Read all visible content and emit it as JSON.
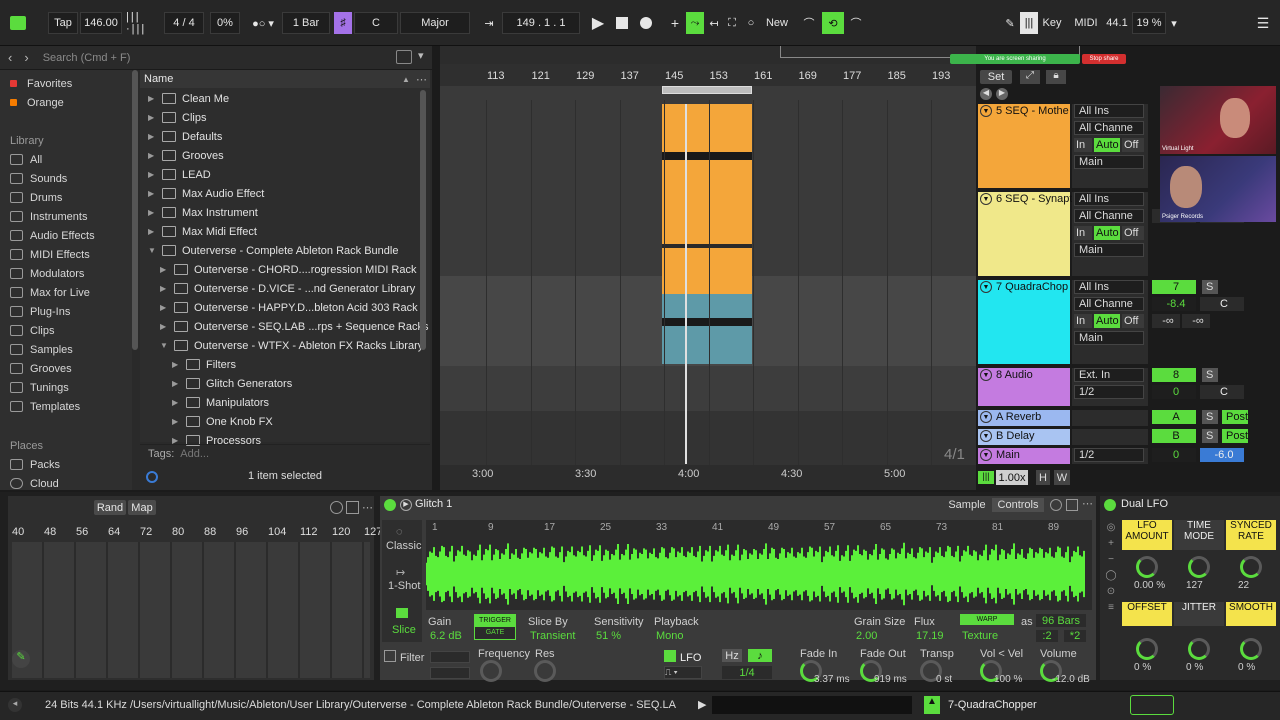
{
  "transport": {
    "tap": "Tap",
    "tempo": "146.00",
    "signature": "4 / 4",
    "swing": "0%",
    "quantize": "1 Bar",
    "key": "C",
    "scale": "Major",
    "position": "149 .   1 .   1",
    "new_label": "New",
    "key_map": "Key",
    "midi_map": "MIDI",
    "sample_rate": "44.1",
    "cpu": "19 %"
  },
  "browser": {
    "search_placeholder": "Search (Cmd + F)",
    "name_header": "Name",
    "collections": [
      {
        "label": "Favorites",
        "color": "#e53935"
      },
      {
        "label": "Orange",
        "color": "#f57c00"
      }
    ],
    "library_header": "Library",
    "library": [
      "All",
      "Sounds",
      "Drums",
      "Instruments",
      "Audio Effects",
      "MIDI Effects",
      "Modulators",
      "Max for Live",
      "Plug-Ins",
      "Clips",
      "Samples",
      "Grooves",
      "Tunings",
      "Templates"
    ],
    "places_header": "Places",
    "places": [
      "Packs",
      "Cloud"
    ],
    "files": [
      {
        "label": "Clean Me",
        "indent": 0,
        "open": false
      },
      {
        "label": "Clips",
        "indent": 0,
        "open": false
      },
      {
        "label": "Defaults",
        "indent": 0,
        "open": false
      },
      {
        "label": "Grooves",
        "indent": 0,
        "open": false
      },
      {
        "label": "LEAD",
        "indent": 0,
        "open": false
      },
      {
        "label": "Max Audio Effect",
        "indent": 0,
        "open": false
      },
      {
        "label": "Max Instrument",
        "indent": 0,
        "open": false
      },
      {
        "label": "Max Midi Effect",
        "indent": 0,
        "open": false
      },
      {
        "label": "Outerverse - Complete Ableton Rack Bundle",
        "indent": 0,
        "open": true
      },
      {
        "label": "Outerverse - CHORD....rogression MIDI Rack",
        "indent": 1,
        "open": false
      },
      {
        "label": "Outerverse - D.VICE - ...nd Generator Library",
        "indent": 1,
        "open": false
      },
      {
        "label": "Outerverse - HAPPY.D...bleton Acid 303 Rack",
        "indent": 1,
        "open": false
      },
      {
        "label": "Outerverse - SEQ.LAB ...rps + Sequence Racks",
        "indent": 1,
        "open": false
      },
      {
        "label": "Outerverse - WTFX - Ableton FX Racks Library",
        "indent": 1,
        "open": true
      },
      {
        "label": "Filters",
        "indent": 2,
        "open": false
      },
      {
        "label": "Glitch Generators",
        "indent": 2,
        "open": false
      },
      {
        "label": "Manipulators",
        "indent": 2,
        "open": false
      },
      {
        "label": "One Knob FX",
        "indent": 2,
        "open": false
      },
      {
        "label": "Processors",
        "indent": 2,
        "open": false
      }
    ],
    "tags_label": "Tags:",
    "tags_placeholder": "Add...",
    "status": "1 item selected"
  },
  "arrangement": {
    "bar_numbers": [
      "113",
      "121",
      "129",
      "137",
      "145",
      "153",
      "161",
      "169",
      "177",
      "185",
      "193"
    ],
    "time_markers": [
      "3:00",
      "3:30",
      "4:00",
      "4:30",
      "5:00"
    ],
    "set_label": "Set",
    "signature_display": "4/1",
    "zoom": "1.00x",
    "h_label": "H",
    "w_label": "W",
    "screen_share_text": "You are screen sharing",
    "stop_share": "Stop share"
  },
  "tracks": [
    {
      "name": "5 SEQ - Mothe",
      "color": "#f4a63a",
      "input": "All Ins",
      "channel": "All Channe",
      "output": "Main",
      "monitor": [
        "In",
        "Auto",
        "Off"
      ]
    },
    {
      "name": "6 SEQ - Synapt",
      "color": "#f0e88a",
      "input": "All Ins",
      "channel": "All Channe",
      "output": "Main",
      "monitor": [
        "In",
        "Auto",
        "Off"
      ],
      "vol": "-∞",
      "pan": "-∞"
    },
    {
      "name": "7 QuadraChop",
      "color": "#22e6f0",
      "input": "All Ins",
      "channel": "All Channe",
      "output": "Main",
      "monitor": [
        "In",
        "Auto",
        "Off"
      ],
      "num": "7",
      "vol": "-8.4",
      "pan": "C",
      "sends": [
        "-∞",
        "-∞"
      ]
    },
    {
      "name": "8 Audio",
      "color": "#c47be0",
      "input": "Ext. In",
      "channel": "1/2",
      "num": "8",
      "vol": "0",
      "pan": "C"
    },
    {
      "name": "A Reverb",
      "color": "#9bb8f0",
      "num": "A",
      "post": "Post"
    },
    {
      "name": "B Delay",
      "color": "#a9c4f2",
      "num": "B",
      "post": "Post"
    },
    {
      "name": "Main",
      "color": "#c47be0",
      "input": "1/2",
      "vol": "0",
      "pan": "-6.0"
    }
  ],
  "webcam": {
    "name1": "Virtual Light",
    "name2": "Psiger Records"
  },
  "drum": {
    "rand": "Rand",
    "map": "Map",
    "ruler": [
      "40",
      "48",
      "56",
      "64",
      "72",
      "80",
      "88",
      "96",
      "104",
      "112",
      "120",
      "127"
    ]
  },
  "simpler": {
    "title": "Glitch 1",
    "tab_sample": "Sample",
    "tab_controls": "Controls",
    "modes": [
      "Classic",
      "1-Shot",
      "Slice"
    ],
    "ruler": [
      "1",
      "9",
      "17",
      "25",
      "33",
      "41",
      "49",
      "57",
      "65",
      "73",
      "81",
      "89"
    ],
    "gain_label": "Gain",
    "gain": "6.2 dB",
    "trigger": "TRIGGER",
    "gate": "GATE",
    "slice_by_label": "Slice By",
    "slice_by": "Transient",
    "sensitivity_label": "Sensitivity",
    "sensitivity": "51 %",
    "playback_label": "Playback",
    "playback": "Mono",
    "grain_label": "Grain Size",
    "grain": "2.00",
    "flux_label": "Flux",
    "flux": "17.19",
    "warp": "WARP",
    "warp_mode": "Texture",
    "as_label": "as",
    "bars": "96 Bars",
    "half": ":2",
    "double": "*2",
    "filter_label": "Filter",
    "freq_label": "Frequency",
    "res_label": "Res",
    "lfo_label": "LFO",
    "hz_label": "Hz",
    "lfo_rate": "1/4",
    "fade_in_label": "Fade In",
    "fade_in": "3.37 ms",
    "fade_out_label": "Fade Out",
    "fade_out": "919 ms",
    "transp_label": "Transp",
    "transp": "0 st",
    "velvol_label": "Vol < Vel",
    "velvol": "100 %",
    "volume_label": "Volume",
    "volume": "-12.0 dB"
  },
  "lfo_device": {
    "title": "Dual LFO",
    "params": [
      {
        "label": "LFO AMOUNT",
        "value": "0.00 %",
        "yellow": true
      },
      {
        "label": "TIME MODE",
        "value": "127",
        "yellow": false
      },
      {
        "label": "SYNCED RATE",
        "value": "22",
        "yellow": true
      },
      {
        "label": "OFFSET",
        "value": "0 %",
        "yellow": true
      },
      {
        "label": "JITTER",
        "value": "0 %",
        "yellow": false
      },
      {
        "label": "SMOOTH",
        "value": "0 %",
        "yellow": true
      }
    ]
  },
  "statusbar": {
    "path": "24 Bits 44.1 KHz /Users/virtuallight/Music/Ableton/User Library/Outerverse - Complete Ableton Rack Bundle/Outerverse - SEQ.LA",
    "track": "7-QuadraChopper"
  }
}
